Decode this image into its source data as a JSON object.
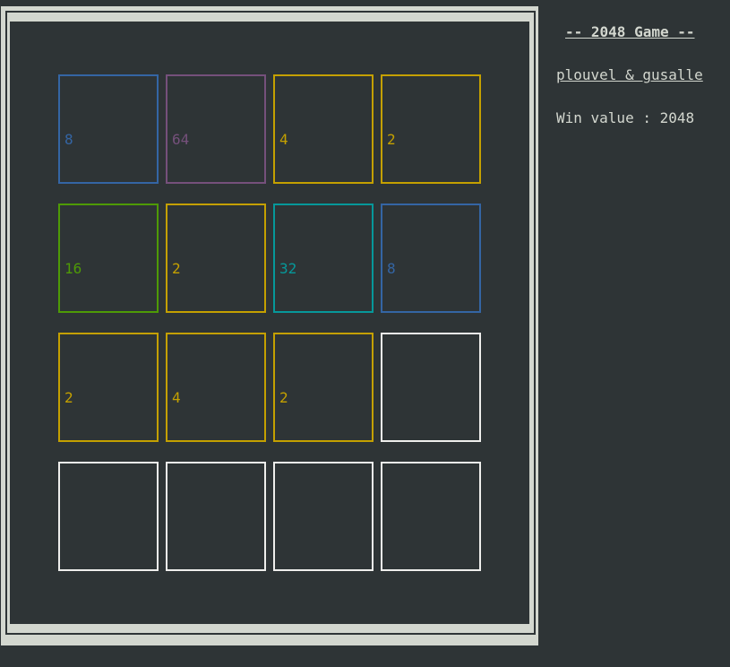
{
  "game": {
    "title": "-- 2048 Game --",
    "authors": "plouvel & gusalle",
    "win_label": "Win value : 2048"
  },
  "board": {
    "rows": [
      [
        {
          "value": "8",
          "color": "#3465a4"
        },
        {
          "value": "64",
          "color": "#75507b"
        },
        {
          "value": "4",
          "color": "#c4a000"
        },
        {
          "value": "2",
          "color": "#c4a000"
        }
      ],
      [
        {
          "value": "16",
          "color": "#4e9a06"
        },
        {
          "value": "2",
          "color": "#c4a000"
        },
        {
          "value": "32",
          "color": "#06989a"
        },
        {
          "value": "8",
          "color": "#3465a4"
        }
      ],
      [
        {
          "value": "2",
          "color": "#c4a000"
        },
        {
          "value": "4",
          "color": "#c4a000"
        },
        {
          "value": "2",
          "color": "#c4a000"
        },
        {
          "value": "",
          "color": "#eeeeec"
        }
      ],
      [
        {
          "value": "",
          "color": "#eeeeec"
        },
        {
          "value": "",
          "color": "#eeeeec"
        },
        {
          "value": "",
          "color": "#eeeeec"
        },
        {
          "value": "",
          "color": "#eeeeec"
        }
      ]
    ]
  },
  "colors": {
    "background": "#2e3436",
    "frame": "#d3d7cf",
    "empty_tile": "#eeeeec"
  }
}
